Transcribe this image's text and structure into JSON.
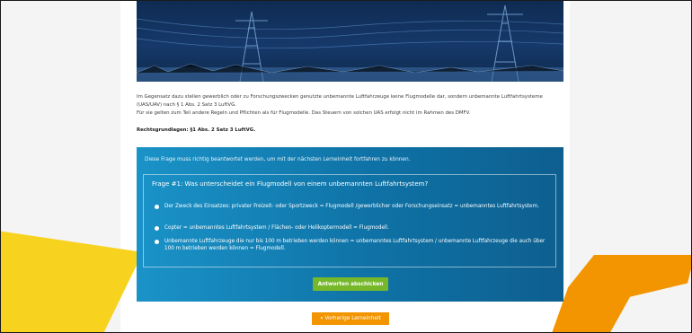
{
  "intro": {
    "line1": "Im Gegensatz dazu stellen gewerblich oder zu Forschungszwecken genutzte unbemannte Luftfahrzeuge keine Flugmodelle dar, sondern unbemannte Luftfahrtsysteme (UAS/UAV) nach § 1 Abs. 2 Satz 3 LuftVG.",
    "line2": "Für sie gelten zum Teil andere Regeln und Pflichten als für Flugmodelle. Das Steuern von solchen UAS erfolgt nicht im Rahmen des DMFV."
  },
  "legal_basis": "Rechtsgrundlagen: §1 Abs. 2 Satz 3 LuftVG.",
  "quiz": {
    "notice": "Diese Frage muss richtig beantwortet werden, um mit der nächsten Lerneinheit fortfahren zu können.",
    "question": "Frage #1: Was unterscheidet ein Flugmodell von einem unbemannten Luftfahrtsystem?",
    "options": [
      "Der Zweck des Einsatzes: privater Freizeit- oder Sportzweck = Flugmodell /gewerblicher oder Forschungseinsatz = unbemanntes Luftfahrtsystem.",
      "Copter = unbemanntes Luftfahrtsystem / Flächen- oder Helikoptermodell = Flugmodell.",
      "Unbemannte Luftfahrzeuge die nur bis 100 m betrieben werden können = unbemanntes Luftfahrtsystem / unbemannte Luftfahrzeuge die auch über 100 m betrieben werden können = Flugmodell."
    ],
    "submit_label": "Antworten abschicken"
  },
  "nav": {
    "prev_label": "« Vorherige Lerneinheit"
  },
  "colors": {
    "accent_yellow": "#f7d21e",
    "accent_orange": "#f29500",
    "submit_green": "#76b82a",
    "quiz_blue": "#1a93c8"
  }
}
